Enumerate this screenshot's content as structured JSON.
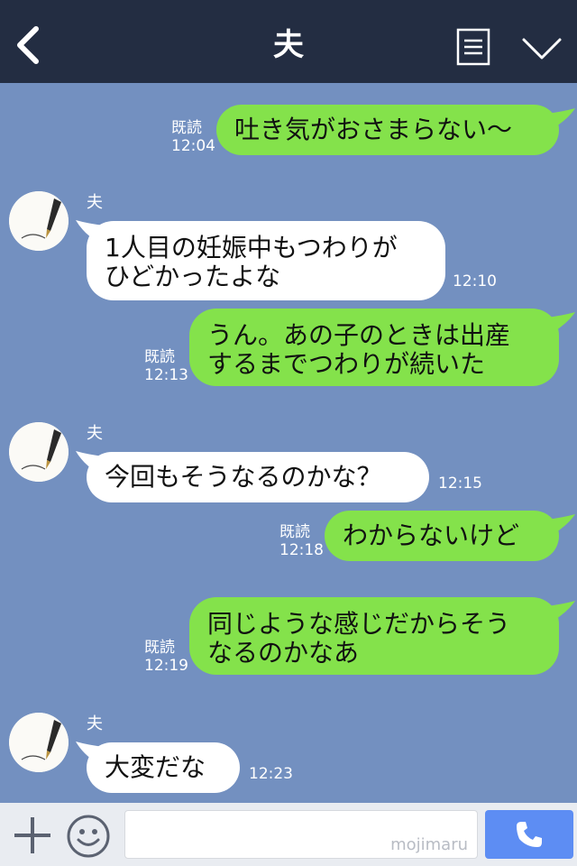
{
  "header": {
    "title": "夫",
    "back_icon": "chevron-left-icon",
    "menu_icon": "list-icon",
    "collapse_icon": "chevron-down-icon"
  },
  "colors": {
    "header_bg": "#232d42",
    "chat_bg": "#7390c0",
    "outgoing_bubble": "#84e24b",
    "incoming_bubble": "#ffffff",
    "call_button": "#5d8df3"
  },
  "messages": [
    {
      "direction": "out",
      "text_lines": [
        "吐き気がおさまらない〜"
      ],
      "read_label": "既読",
      "time": "12:04"
    },
    {
      "direction": "in",
      "sender": "夫",
      "text_lines": [
        "1人目の妊娠中もつわりが",
        "ひどかったよな"
      ],
      "time": "12:10"
    },
    {
      "direction": "out",
      "text_lines": [
        "うん。あの子のときは出産",
        "するまでつわりが続いた"
      ],
      "read_label": "既読",
      "time": "12:13"
    },
    {
      "direction": "in",
      "sender": "夫",
      "text_lines": [
        "今回もそうなるのかな？"
      ],
      "time": "12:15"
    },
    {
      "direction": "out",
      "text_lines": [
        "わからないけど"
      ],
      "read_label": "既読",
      "time": "12:18"
    },
    {
      "direction": "out",
      "text_lines": [
        "同じような感じだからそう",
        "なるのかなあ"
      ],
      "read_label": "既読",
      "time": "12:19"
    },
    {
      "direction": "in",
      "sender": "夫",
      "text_lines": [
        "大変だな"
      ],
      "time": "12:23"
    }
  ],
  "footer": {
    "plus_icon": "plus-icon",
    "emoji_icon": "smile-icon",
    "input_value": "",
    "watermark": "mojimaru",
    "call_icon": "phone-icon"
  }
}
